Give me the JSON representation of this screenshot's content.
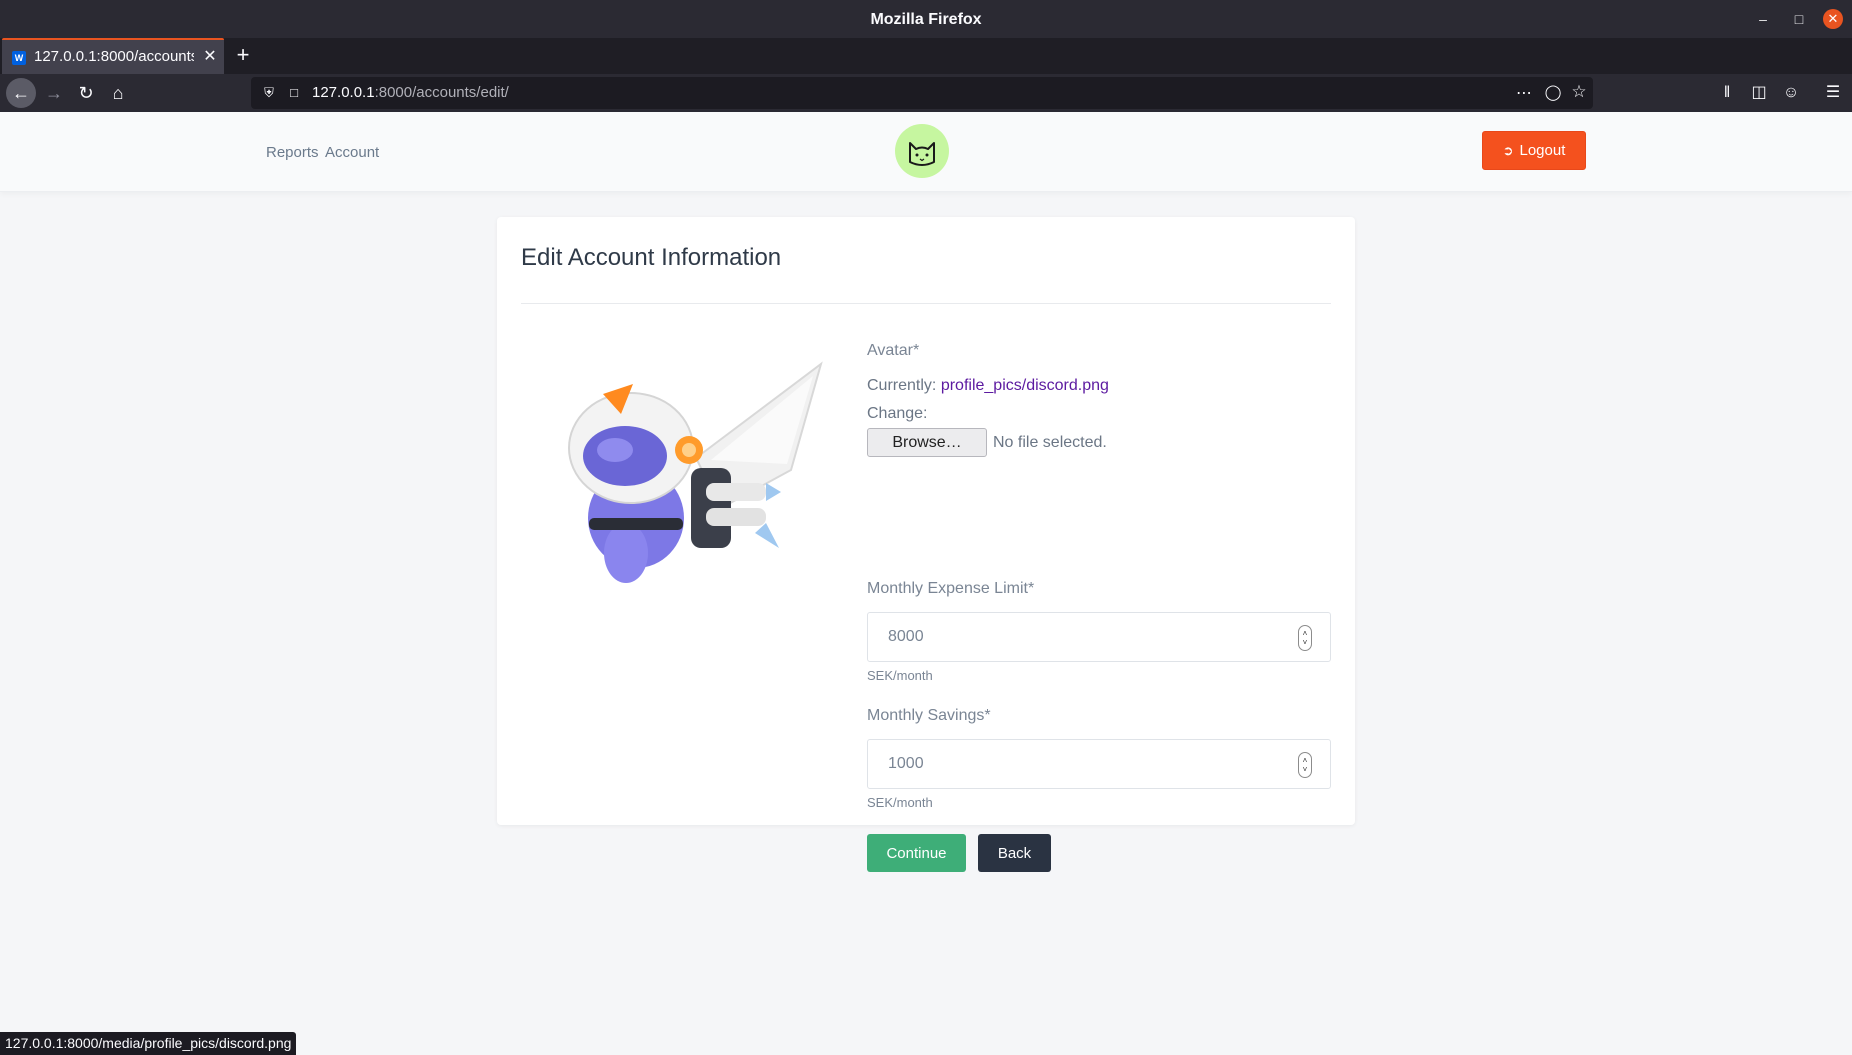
{
  "window": {
    "title": "Mozilla Firefox"
  },
  "tab": {
    "title": "127.0.0.1:8000/accounts/edit/",
    "favicon": "W"
  },
  "url": {
    "host": "127.0.0.1",
    "rest": ":8000/accounts/edit/"
  },
  "header": {
    "nav": [
      {
        "label": "Reports"
      },
      {
        "label": "Account"
      }
    ],
    "logout_label": "Logout"
  },
  "card": {
    "title": "Edit Account Information"
  },
  "form": {
    "avatar_label": "Avatar*",
    "currently_prefix": "Currently:",
    "current_file": "profile_pics/discord.png",
    "change_label": "Change:",
    "browse_label": "Browse…",
    "file_status": "No file selected.",
    "expense_label": "Monthly Expense Limit*",
    "expense_value": "8000",
    "expense_unit": "SEK/month",
    "savings_label": "Monthly Savings*",
    "savings_value": "1000",
    "savings_unit": "SEK/month",
    "continue_label": "Continue",
    "back_label": "Back"
  },
  "status_bar": {
    "url": "127.0.0.1:8000/media/profile_pics/discord.png"
  },
  "colors": {
    "accent": "#f4511e",
    "continue": "#3eae78",
    "back": "#2a3342",
    "link": "#5c1aa0"
  }
}
